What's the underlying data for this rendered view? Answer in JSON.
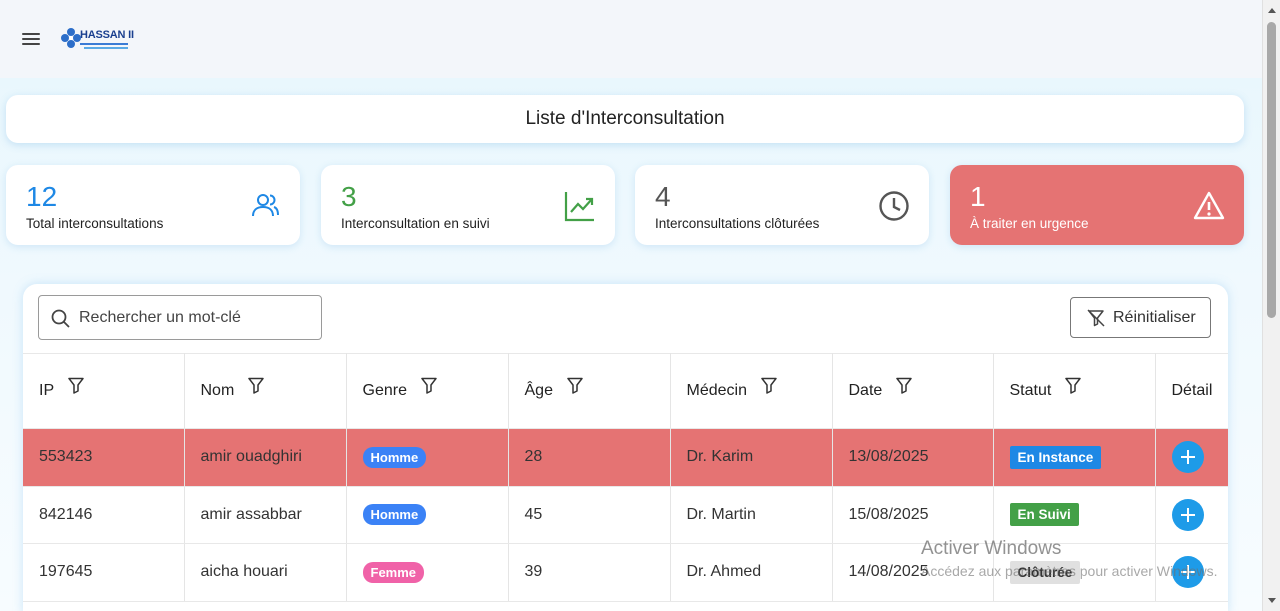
{
  "header": {
    "logo_text": "HASSAN II",
    "logo_alt": "CHU Hassan II logo"
  },
  "page_title": "Liste d'Interconsultation",
  "stats": [
    {
      "value": "12",
      "label": "Total interconsultations",
      "color": "#1e88e5",
      "icon": "users-icon"
    },
    {
      "value": "3",
      "label": "Interconsultation en suivi",
      "color": "#43a047",
      "icon": "trending-up-icon"
    },
    {
      "value": "4",
      "label": "Interconsultations clôturées",
      "color": "#555555",
      "icon": "clock-icon"
    },
    {
      "value": "1",
      "label": "À traiter en urgence",
      "color": "#ffffff",
      "icon": "warning-icon"
    }
  ],
  "search": {
    "placeholder": "Rechercher un mot-clé",
    "value": ""
  },
  "reset_label": "Réinitialiser",
  "columns": [
    "IP",
    "Nom",
    "Genre",
    "Âge",
    "Médecin",
    "Date",
    "Statut",
    "Détail"
  ],
  "rows": [
    {
      "ip": "553423",
      "nom": "amir ouadghiri",
      "genre": "Homme",
      "age": "28",
      "medecin": "Dr. Karim",
      "date": "13/08/2025",
      "statut": "En Instance"
    },
    {
      "ip": "842146",
      "nom": "amir assabbar",
      "genre": "Homme",
      "age": "45",
      "medecin": "Dr. Martin",
      "date": "15/08/2025",
      "statut": "En Suivi"
    },
    {
      "ip": "197645",
      "nom": "aicha houari",
      "genre": "Femme",
      "age": "39",
      "medecin": "Dr. Ahmed",
      "date": "14/08/2025",
      "statut": "Clôturée"
    }
  ],
  "watermark": {
    "line1": "Activer Windows",
    "line2": "Accédez aux paramètres pour activer Windows."
  },
  "colors": {
    "urgent": "#e57373",
    "accent": "#1e9be8",
    "homme": "#3b82f6",
    "femme": "#f062a8"
  }
}
